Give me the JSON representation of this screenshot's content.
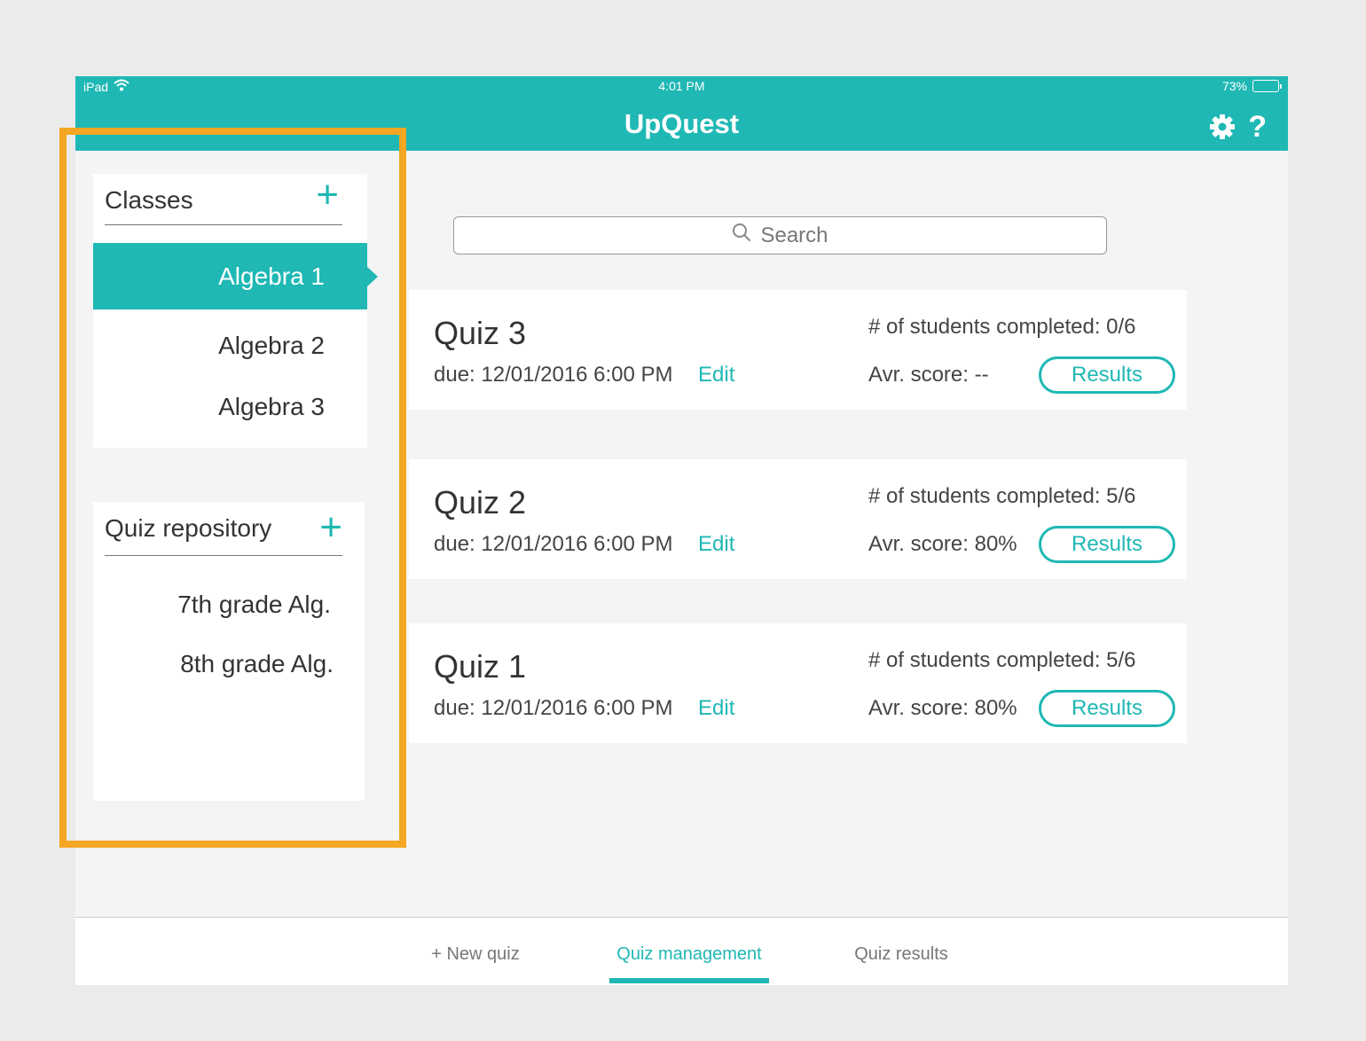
{
  "status_bar": {
    "device": "iPad",
    "time": "4:01 PM",
    "battery": "73%",
    "battery_level": 0.73
  },
  "header": {
    "title": "UpQuest",
    "help_label": "?",
    "icons": [
      "gear-icon",
      "help-icon"
    ]
  },
  "classes": {
    "title": "Classes",
    "add_label": "+",
    "items": [
      {
        "label": "Algebra 1",
        "selected": true
      },
      {
        "label": "Algebra 2",
        "selected": false
      },
      {
        "label": "Algebra 3",
        "selected": false
      }
    ]
  },
  "quiz_repository": {
    "title": "Quiz repository",
    "add_label": "+",
    "items": [
      "7th grade Alg.",
      "8th grade Alg."
    ]
  },
  "search": {
    "placeholder": "Search"
  },
  "quizzes": [
    {
      "name": "Quiz 3",
      "due": "due: 12/01/2016 6:00 PM",
      "edit": "Edit",
      "completed": "# of students completed: 0/6",
      "avg": "Avr. score: --",
      "results": "Results"
    },
    {
      "name": "Quiz 2",
      "due": "due: 12/01/2016 6:00 PM",
      "edit": "Edit",
      "completed": "# of students completed: 5/6",
      "avg": "Avr. score: 80%",
      "results": "Results"
    },
    {
      "name": "Quiz 1",
      "due": "due: 12/01/2016 6:00 PM",
      "edit": "Edit",
      "completed": "# of students completed: 5/6",
      "avg": "Avr. score: 80%",
      "results": "Results"
    }
  ],
  "bottom_tabs": [
    {
      "label": "+ New quiz",
      "active": false
    },
    {
      "label": "Quiz management",
      "active": true
    },
    {
      "label": "Quiz results",
      "active": false
    }
  ],
  "colors": {
    "accent": "#1fb8b4",
    "highlight": "#f5a623",
    "background": "#f4f4f4"
  }
}
